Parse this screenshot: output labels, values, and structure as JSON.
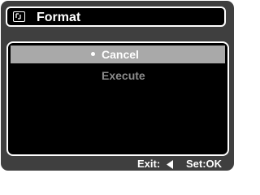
{
  "title": {
    "icon": "format-icon",
    "text": "Format"
  },
  "menu": {
    "items": [
      {
        "label": "Cancel",
        "selected": true
      },
      {
        "label": "Execute",
        "selected": false
      }
    ]
  },
  "footer": {
    "exit_label": "Exit:",
    "exit_icon": "left-arrow-icon",
    "set_label": "Set:OK"
  },
  "colors": {
    "screen_bg": "#3f3f3f",
    "panel_bg": "#000000",
    "highlight": "#a9a9a9",
    "inactive_text": "#8c8c8c",
    "text": "#ffffff"
  }
}
